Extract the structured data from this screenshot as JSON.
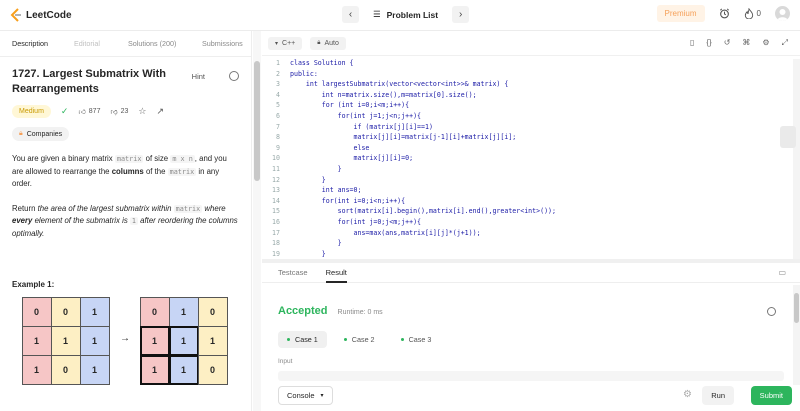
{
  "topbar": {
    "logo_text": "LeetCode",
    "problem_list_label": "Problem List",
    "premium_label": "Premium",
    "streak_count": "0"
  },
  "left_tabs": [
    "Description",
    "Editorial",
    "Solutions (200)",
    "Submissions"
  ],
  "problem": {
    "title": "1727. Largest Submatrix With Rearrangements",
    "hint_label": "Hint",
    "difficulty": "Medium",
    "likes": "877",
    "dislikes": "23",
    "companies_label": "Companies",
    "description_1_a": "You are given a binary matrix",
    "description_1_code1": "matrix",
    "description_1_b": "of size",
    "description_1_code2": "m x n",
    "description_1_c": ", and you are allowed to rearrange the",
    "description_1_bold": "columns",
    "description_1_d": "of the",
    "description_1_code3": "matrix",
    "description_1_e": "in any order.",
    "description_2_a": "Return",
    "description_2_italic1": "the area of the largest submatrix within",
    "description_2_code1": "matrix",
    "description_2_italic2": "where",
    "description_2_bold": "every",
    "description_2_italic3": "element of the submatrix is",
    "description_2_code2": "1",
    "description_2_italic4": "after reordering the columns optimally.",
    "example_title": "Example 1:",
    "matrix_left": [
      [
        "0",
        "0",
        "1"
      ],
      [
        "1",
        "1",
        "1"
      ],
      [
        "1",
        "0",
        "1"
      ]
    ],
    "matrix_right": [
      [
        "0",
        "1",
        "0"
      ],
      [
        "1",
        "1",
        "1"
      ],
      [
        "1",
        "1",
        "0"
      ]
    ],
    "arrow": "→"
  },
  "editor": {
    "language": "C++",
    "mode": "Auto",
    "lines": [
      "class Solution {",
      "public:",
      "    int largestSubmatrix(vector<vector<int>>& matrix) {",
      "        int n=matrix.size(),m=matrix[0].size();",
      "        for (int i=0;i<m;i++){",
      "            for(int j=1;j<n;j++){",
      "                if (matrix[j][i]==1)",
      "                matrix[j][i]=matrix[j-1][i]+matrix[j][i];",
      "                else",
      "                matrix[j][i]=0;",
      "            }",
      "        }",
      "        int ans=0;",
      "        for(int i=0;i<n;i++){",
      "            sort(matrix[i].begin(),matrix[i].end(),greater<int>());",
      "            for(int j=0;j<m;j++){",
      "                ans=max(ans,matrix[i][j]*(j+1));",
      "            }",
      "        }"
    ]
  },
  "result": {
    "tabs": [
      "Testcase",
      "Result"
    ],
    "status": "Accepted",
    "runtime": "Runtime: 0 ms",
    "cases": [
      "Case 1",
      "Case 2",
      "Case 3"
    ],
    "input_label": "Input",
    "console_label": "Console",
    "run_label": "Run",
    "submit_label": "Submit"
  },
  "colors": {
    "accent_green": "#2db55d",
    "premium_orange": "#f5a05a",
    "difficulty_yellow": "#c99a00"
  }
}
